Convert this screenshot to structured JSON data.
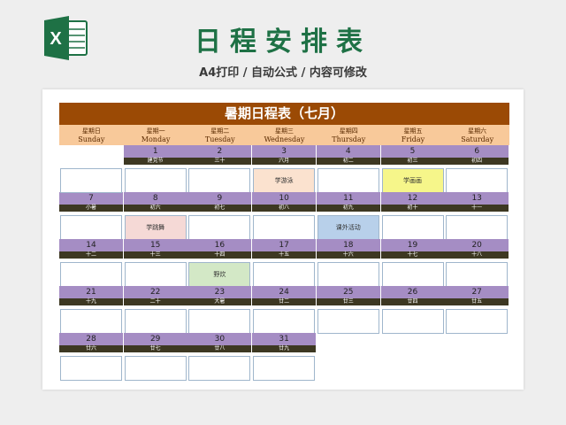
{
  "header": {
    "title": "日程安排表",
    "subtitle": "A4打印 / 自动公式 / 内容可修改",
    "logo_icon": "excel-icon",
    "logo_letter": "X",
    "logo_color": "#1e7145"
  },
  "sheet": {
    "title": "暑期日程表（七月）",
    "title_bg": "#9b4a05",
    "weekdays": [
      {
        "cn": "星期日",
        "en": "Sunday"
      },
      {
        "cn": "星期一",
        "en": "Monday"
      },
      {
        "cn": "星期二",
        "en": "Tuesday"
      },
      {
        "cn": "星期三",
        "en": "Wednesday"
      },
      {
        "cn": "星期四",
        "en": "Thursday"
      },
      {
        "cn": "星期五",
        "en": "Friday"
      },
      {
        "cn": "星期六",
        "en": "Saturday"
      }
    ],
    "days": [
      {
        "day": "1",
        "lunar": "建党节",
        "event": ""
      },
      {
        "day": "2",
        "lunar": "三十",
        "event": ""
      },
      {
        "day": "3",
        "lunar": "六月",
        "event": "学游泳",
        "color": "peach"
      },
      {
        "day": "4",
        "lunar": "初二",
        "event": ""
      },
      {
        "day": "5",
        "lunar": "初三",
        "event": "学画画",
        "color": "yellow"
      },
      {
        "day": "6",
        "lunar": "初四",
        "event": ""
      },
      {
        "day": "7",
        "lunar": "小暑",
        "event": ""
      },
      {
        "day": "8",
        "lunar": "初六",
        "event": "学跳舞",
        "color": "pink"
      },
      {
        "day": "9",
        "lunar": "初七",
        "event": ""
      },
      {
        "day": "10",
        "lunar": "初八",
        "event": ""
      },
      {
        "day": "11",
        "lunar": "初九",
        "event": "课外活动",
        "color": "blue"
      },
      {
        "day": "12",
        "lunar": "初十",
        "event": ""
      },
      {
        "day": "13",
        "lunar": "十一",
        "event": ""
      },
      {
        "day": "14",
        "lunar": "十二",
        "event": ""
      },
      {
        "day": "15",
        "lunar": "十三",
        "event": ""
      },
      {
        "day": "16",
        "lunar": "十四",
        "event": "野炊",
        "color": "green"
      },
      {
        "day": "17",
        "lunar": "十五",
        "event": ""
      },
      {
        "day": "18",
        "lunar": "十六",
        "event": ""
      },
      {
        "day": "19",
        "lunar": "十七",
        "event": ""
      },
      {
        "day": "20",
        "lunar": "十八",
        "event": ""
      },
      {
        "day": "21",
        "lunar": "十九",
        "event": ""
      },
      {
        "day": "22",
        "lunar": "二十",
        "event": ""
      },
      {
        "day": "23",
        "lunar": "大暑",
        "event": ""
      },
      {
        "day": "24",
        "lunar": "廿二",
        "event": ""
      },
      {
        "day": "25",
        "lunar": "廿三",
        "event": ""
      },
      {
        "day": "26",
        "lunar": "廿四",
        "event": ""
      },
      {
        "day": "27",
        "lunar": "廿五",
        "event": ""
      },
      {
        "day": "28",
        "lunar": "廿六",
        "event": ""
      },
      {
        "day": "29",
        "lunar": "廿七",
        "event": ""
      },
      {
        "day": "30",
        "lunar": "廿八",
        "event": ""
      },
      {
        "day": "31",
        "lunar": "廿九",
        "event": ""
      }
    ]
  }
}
